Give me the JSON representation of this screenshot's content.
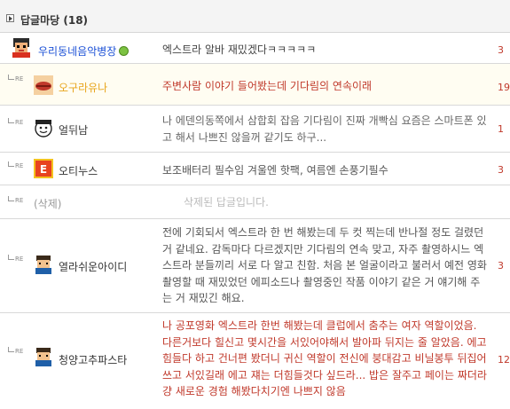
{
  "board": {
    "title": "답글마당",
    "count": "(18)"
  },
  "re_label": "RE",
  "replies": [
    {
      "author": "우리동네음악병장",
      "text": "엑스트라 알바 재밌겠다ㅋㅋㅋㅋㅋ",
      "count": "3",
      "author_color": "#1a4fd6",
      "text_color": "#444444",
      "online": true,
      "avatar": "drummer"
    },
    {
      "author": "오구라유나",
      "text": "주변사람 이야기 들어봤는데 기다림의 연속이래",
      "count": "19",
      "author_color": "#e8a51c",
      "text_color": "#c0392b",
      "avatar": "lips"
    },
    {
      "author": "얼뒤남",
      "text": "나 에덴의동쪽에서 삼합회 잡음 기다림이 진짜 개빡심 요즘은 스마트폰 있고 해서 나쁘진 않을꺼 같기도 하구...",
      "count": "1",
      "author_color": "#333333",
      "text_color": "#666666",
      "avatar": "face"
    },
    {
      "author": "오티누스",
      "text": "보조배터리 필수임 겨울엔 핫팩, 여름엔 손풍기필수",
      "count": "3",
      "author_color": "#333333",
      "text_color": "#555555",
      "avatar": "badge"
    },
    {
      "author": "(삭제)",
      "text": "삭제된 답글입니다.",
      "count": "",
      "author_color": "#999999",
      "text_color": "#bbbbbb",
      "avatar": ""
    },
    {
      "author": "열라쉬운아이디",
      "text": "전에 기회되서 엑스트라 한 번 해봤는데 두 컷 찍는데 반나절 정도 걸렸던 거 같네요. 감독마다 다르겠지만 기다림의 연속 맞고, 자주 촬영하시느 엑스트라 분들끼리 서로 다 알고 친함. 처음 본 얼굴이라고 불러서 예전 영화 촬영할 때 재밌었던 에피소드나 촬영중인 작품 이야기 같은 거 얘기해 주는 거 재밌긴 해요.",
      "count": "3",
      "author_color": "#333333",
      "text_color": "#555555",
      "avatar": "pixel"
    },
    {
      "author": "청양고추파스타",
      "text": "나 공포영화 엑스트라 한번 해봤는데 클럽에서 춤추는 여자 역할이었음. 다른거보다 힐신고 몇시간을 서있어야해서 발아파 뒤지는 줄 알았음. 에고 힘들다 하고 건너편 봤더니 귀신 역할이 전신에 붕대감고 비닐봉투 뒤집어쓰고 서있길래 에고 쟤는 더힘들것다 싶드라... 밥은 잘주고 페이는 짜더라 걍 새로운 경험 해봤다치기엔 나쁘지 않음",
      "count": "12",
      "author_color": "#333333",
      "text_color": "#c0392b",
      "avatar": "pixel"
    }
  ]
}
